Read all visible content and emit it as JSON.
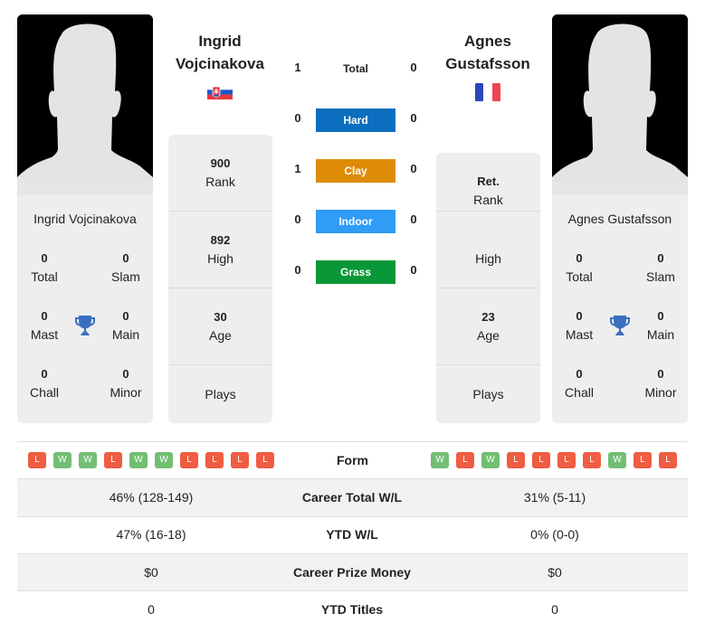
{
  "player1": {
    "name_line1": "Ingrid",
    "name_line2": "Vojcinakova",
    "full_name": "Ingrid Vojcinakova",
    "flag": "slovakia-flag",
    "titles": {
      "total": {
        "value": "0",
        "label": "Total"
      },
      "slam": {
        "value": "0",
        "label": "Slam"
      },
      "mast": {
        "value": "0",
        "label": "Mast"
      },
      "main": {
        "value": "0",
        "label": "Main"
      },
      "chall": {
        "value": "0",
        "label": "Chall"
      },
      "minor": {
        "value": "0",
        "label": "Minor"
      }
    },
    "stats": {
      "rank": {
        "value": "900",
        "label": "Rank"
      },
      "high": {
        "value": "892",
        "label": "High"
      },
      "age": {
        "value": "30",
        "label": "Age"
      },
      "plays": {
        "value": "",
        "label": "Plays"
      }
    },
    "form": [
      "L",
      "W",
      "W",
      "L",
      "W",
      "W",
      "L",
      "L",
      "L",
      "L"
    ]
  },
  "player2": {
    "name_line1": "Agnes",
    "name_line2": "Gustafsson",
    "full_name": "Agnes Gustafsson",
    "flag": "france-flag",
    "titles": {
      "total": {
        "value": "0",
        "label": "Total"
      },
      "slam": {
        "value": "0",
        "label": "Slam"
      },
      "mast": {
        "value": "0",
        "label": "Mast"
      },
      "main": {
        "value": "0",
        "label": "Main"
      },
      "chall": {
        "value": "0",
        "label": "Chall"
      },
      "minor": {
        "value": "0",
        "label": "Minor"
      }
    },
    "stats": {
      "rank": {
        "value": "Ret.",
        "label": "Rank"
      },
      "high": {
        "value": "",
        "label": "High"
      },
      "age": {
        "value": "23",
        "label": "Age"
      },
      "plays": {
        "value": "",
        "label": "Plays"
      }
    },
    "form": [
      "W",
      "L",
      "W",
      "L",
      "L",
      "L",
      "L",
      "W",
      "L",
      "L"
    ]
  },
  "h2h": {
    "total": {
      "label": "Total",
      "p1": "1",
      "p2": "0"
    },
    "surfaces": [
      {
        "label": "Hard",
        "p1": "0",
        "p2": "0",
        "color": "#0c6ebe"
      },
      {
        "label": "Clay",
        "p1": "1",
        "p2": "0",
        "color": "#de8b06"
      },
      {
        "label": "Indoor",
        "p1": "0",
        "p2": "0",
        "color": "#2f9cf5"
      },
      {
        "label": "Grass",
        "p1": "0",
        "p2": "0",
        "color": "#0a9737"
      }
    ]
  },
  "comparison": {
    "form_label": "Form",
    "rows": [
      {
        "label": "Career Total W/L",
        "p1": "46% (128-149)",
        "p2": "31% (5-11)"
      },
      {
        "label": "YTD W/L",
        "p1": "47% (16-18)",
        "p2": "0% (0-0)"
      },
      {
        "label": "Career Prize Money",
        "p1": "$0",
        "p2": "$0"
      },
      {
        "label": "YTD Titles",
        "p1": "0",
        "p2": "0"
      }
    ]
  },
  "colors": {
    "win": "#72bf73",
    "loss": "#ef5d42",
    "trophy": "#3a6fc0"
  }
}
